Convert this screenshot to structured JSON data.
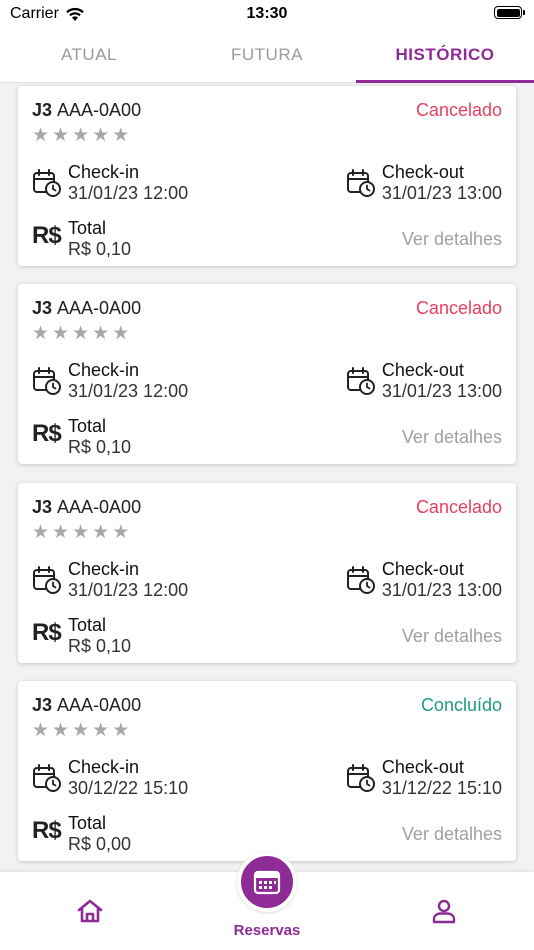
{
  "status_bar": {
    "carrier": "Carrier",
    "time": "13:30"
  },
  "tabs": [
    {
      "label": "ATUAL",
      "active": false
    },
    {
      "label": "FUTURA",
      "active": false
    },
    {
      "label": "HISTÓRICO",
      "active": true
    }
  ],
  "colors": {
    "accent": "#8e2b97",
    "cancelled": "#e5405e",
    "completed": "#1e9c7c"
  },
  "cards": [
    {
      "code": "J3",
      "plate": "AAA-0A00",
      "status": "Cancelado",
      "status_type": "cancelled",
      "checkin_label": "Check-in",
      "checkin": "31/01/23 12:00",
      "checkout_label": "Check-out",
      "checkout": "31/01/23 13:00",
      "total_label": "Total",
      "total": "R$ 0,10",
      "details": "Ver detalhes"
    },
    {
      "code": "J3",
      "plate": "AAA-0A00",
      "status": "Cancelado",
      "status_type": "cancelled",
      "checkin_label": "Check-in",
      "checkin": "31/01/23 12:00",
      "checkout_label": "Check-out",
      "checkout": "31/01/23 13:00",
      "total_label": "Total",
      "total": "R$ 0,10",
      "details": "Ver detalhes"
    },
    {
      "code": "J3",
      "plate": "AAA-0A00",
      "status": "Cancelado",
      "status_type": "cancelled",
      "checkin_label": "Check-in",
      "checkin": "31/01/23 12:00",
      "checkout_label": "Check-out",
      "checkout": "31/01/23 13:00",
      "total_label": "Total",
      "total": "R$ 0,10",
      "details": "Ver detalhes"
    },
    {
      "code": "J3",
      "plate": "AAA-0A00",
      "status": "Concluído",
      "status_type": "completed",
      "checkin_label": "Check-in",
      "checkin": "30/12/22 15:10",
      "checkout_label": "Check-out",
      "checkout": "31/12/22 15:10",
      "total_label": "Total",
      "total": "R$ 0,00",
      "details": "Ver detalhes"
    }
  ],
  "currency_icon_text": "R$",
  "bottom_nav": {
    "home_icon": "home-icon",
    "center_icon": "calendar-icon",
    "center_label": "Reservas",
    "profile_icon": "person-icon"
  }
}
